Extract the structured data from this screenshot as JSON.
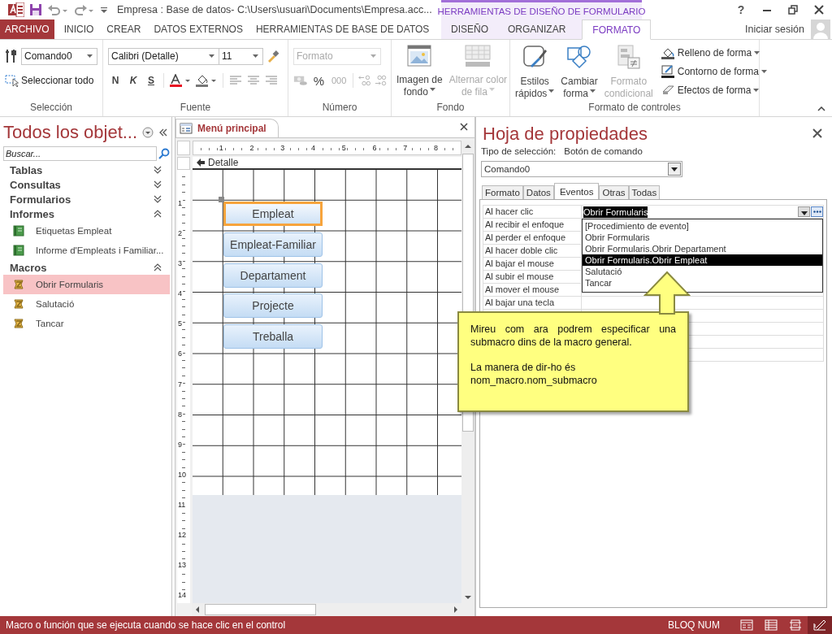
{
  "title_bar": {
    "title": "Empresa : Base de datos- C:\\Users\\usuari\\Documents\\Empresa.acc...",
    "context_group": "HERRAMIENTAS DE DISEÑO DE FORMULARIO",
    "help": "?"
  },
  "ribbon_tabs": [
    {
      "label": "ARCHIVO",
      "kind": "file",
      "selected": false
    },
    {
      "label": "INICIO",
      "kind": "main",
      "selected": false
    },
    {
      "label": "CREAR",
      "kind": "main",
      "selected": false
    },
    {
      "label": "DATOS EXTERNOS",
      "kind": "main",
      "selected": false
    },
    {
      "label": "HERRAMIENTAS DE BASE DE DATOS",
      "kind": "main",
      "selected": false
    },
    {
      "label": "DISEÑO",
      "kind": "context",
      "selected": false
    },
    {
      "label": "ORGANIZAR",
      "kind": "context",
      "selected": false
    },
    {
      "label": "FORMATO",
      "kind": "context",
      "selected": true
    }
  ],
  "account": {
    "label": "Iniciar sesión"
  },
  "ribbon": {
    "selection": {
      "label": "Selección",
      "object": "Comando0",
      "select_all": "Seleccionar todo"
    },
    "font": {
      "label": "Fuente",
      "family": "Calibri (Detalle)",
      "size": "11",
      "bold": "N",
      "italic": "K",
      "underline": "S"
    },
    "number": {
      "label": "Número",
      "format": {
        "placeholder": "Formato",
        "disabled": true
      },
      "percent": "%",
      "thousands": "000"
    },
    "background": {
      "label": "Fondo",
      "buttons": [
        {
          "lines": [
            "Imagen de",
            "fondo"
          ],
          "kind": "image",
          "disabled": false,
          "menu": true
        },
        {
          "lines": [
            "Alternar color",
            "de fila"
          ],
          "kind": "rows",
          "disabled": true,
          "menu": true
        }
      ]
    },
    "controls": {
      "label": "Formato de controles",
      "buttons": [
        {
          "lines": [
            "Estilos",
            "rápidos"
          ],
          "kind": "styles",
          "disabled": false,
          "menu": true
        },
        {
          "lines": [
            "Cambiar",
            "forma"
          ],
          "kind": "shape",
          "disabled": false,
          "menu": true
        },
        {
          "lines": [
            "Formato",
            "condicional"
          ],
          "kind": "conditional",
          "disabled": true,
          "menu": false
        }
      ],
      "small_buttons": [
        {
          "label": "Relleno de forma",
          "kind": "fill"
        },
        {
          "label": "Contorno de forma",
          "kind": "outline"
        },
        {
          "label": "Efectos de forma",
          "kind": "effects"
        }
      ]
    }
  },
  "nav_pane": {
    "title": "Todos los objet...",
    "search": {
      "placeholder": "Buscar..."
    },
    "groups": [
      {
        "label": "Tablas",
        "expanded": false
      },
      {
        "label": "Consultas",
        "expanded": false
      },
      {
        "label": "Formularios",
        "expanded": false
      },
      {
        "label": "Informes",
        "expanded": true,
        "items": [
          {
            "label": "Etiquetas Empleat",
            "kind": "report",
            "selected": false
          },
          {
            "label": "Informe d'Empleats i Familiar...",
            "kind": "report",
            "selected": false
          }
        ]
      },
      {
        "label": "Macros",
        "expanded": true,
        "items": [
          {
            "label": "Obrir Formularis",
            "kind": "macro",
            "selected": true
          },
          {
            "label": "Salutació",
            "kind": "macro",
            "selected": false
          },
          {
            "label": "Tancar",
            "kind": "macro",
            "selected": false
          }
        ]
      }
    ]
  },
  "document": {
    "tab": "Menú principal",
    "h_ruler": [
      "1",
      "2",
      "3",
      "4",
      "5",
      "6",
      "7",
      "8"
    ],
    "v_ruler": [
      "1",
      "2",
      "3",
      "4",
      "5",
      "6",
      "7",
      "8",
      "9",
      "10",
      "11",
      "12",
      "13",
      "14"
    ],
    "section": "Detalle",
    "buttons": [
      {
        "label": "Empleat",
        "selected": true
      },
      {
        "label": "Empleat-Familiar",
        "selected": false
      },
      {
        "label": "Departament",
        "selected": false
      },
      {
        "label": "Projecte",
        "selected": false
      },
      {
        "label": "Treballa",
        "selected": false
      }
    ]
  },
  "property_sheet": {
    "title": "Hoja de propiedades",
    "selection_type_label": "Tipo de selección:",
    "selection_type": "Botón de comando",
    "object": "Comando0",
    "tabs": [
      {
        "label": "Formato",
        "selected": false
      },
      {
        "label": "Datos",
        "selected": false
      },
      {
        "label": "Eventos",
        "selected": true
      },
      {
        "label": "Otras",
        "selected": false
      },
      {
        "label": "Todas",
        "selected": false
      }
    ],
    "rows": [
      {
        "label": "Al hacer clic",
        "value": "Obrir Formularis"
      },
      {
        "label": "Al recibir el enfoque"
      },
      {
        "label": "Al perder el enfoque"
      },
      {
        "label": "Al hacer doble clic"
      },
      {
        "label": "Al bajar el mouse"
      },
      {
        "label": "Al subir el mouse"
      },
      {
        "label": "Al mover el mouse"
      },
      {
        "label": "Al bajar una tecla"
      }
    ],
    "dropdown": [
      {
        "label": "[Procedimiento de evento]",
        "selected": false
      },
      {
        "label": "Obrir Formularis",
        "selected": false
      },
      {
        "label": "Obrir Formularis.Obrir Departament",
        "selected": false
      },
      {
        "label": "Obrir Formularis.Obrir Empleat",
        "selected": true
      },
      {
        "label": "Salutació",
        "selected": false
      },
      {
        "label": "Tancar",
        "selected": false
      }
    ]
  },
  "callout": {
    "paragraphs": [
      "Mireu com ara podrem especificar una submacro dins de la macro general.",
      "La manera de dir-ho és nom_macro.nom_submacro"
    ]
  },
  "status_bar": {
    "message": "Macro o función que se ejecuta cuando se hace clic en el control",
    "num_lock": "BLOQ NUM",
    "views": [
      {
        "kind": "form",
        "selected": false
      },
      {
        "kind": "datasheet",
        "selected": false
      },
      {
        "kind": "layout",
        "selected": false
      },
      {
        "kind": "design",
        "selected": true
      }
    ]
  }
}
